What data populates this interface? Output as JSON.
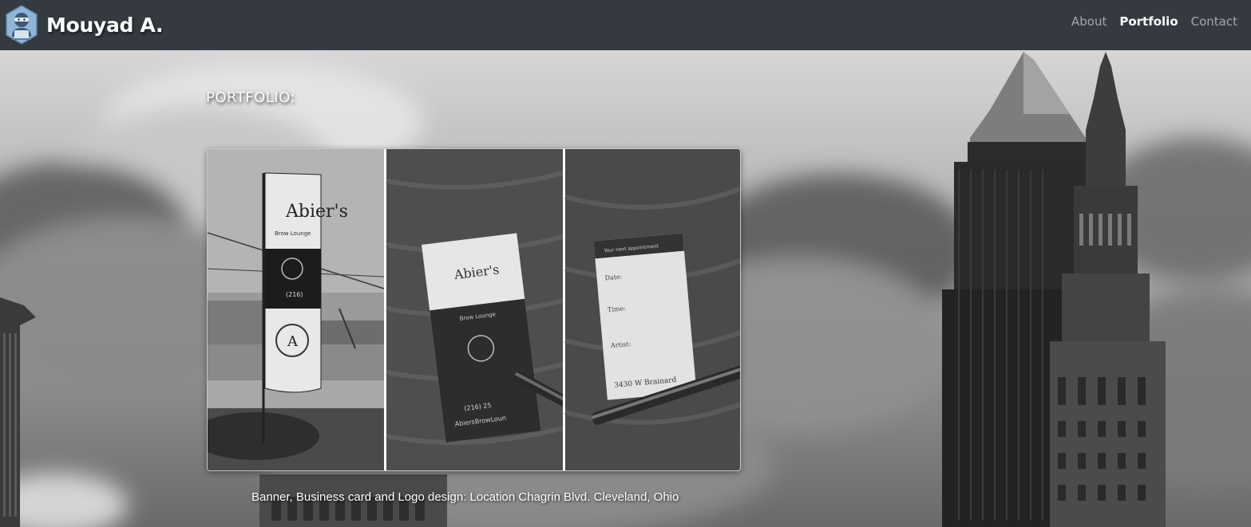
{
  "navbar": {
    "brand_name": "Mouyad A.",
    "links": [
      {
        "label": "About",
        "active": false
      },
      {
        "label": "Portfolio",
        "active": true
      },
      {
        "label": "Contact",
        "active": false
      }
    ]
  },
  "portfolio": {
    "title": "PORTFOLIO:",
    "caption": "Banner, Business card and Logo design: Location Chagrin Blvd. Cleveland, Ohio",
    "images": [
      {
        "icon": "banner-photo",
        "flag_text": [
          "Abier's",
          "Brow Lounge",
          "(216)"
        ]
      },
      {
        "icon": "business-card-photo",
        "card_text": [
          "Abier's",
          "Brow Lounge",
          "(216) 25",
          "AbiersBrowLoun"
        ]
      },
      {
        "icon": "appointment-card-photo",
        "card_text": [
          "Your next appointment",
          "Date:",
          "Time:",
          "Artist:",
          "3430 W Brainard"
        ]
      }
    ]
  },
  "colors": {
    "navbar": "#343a40",
    "nav_active": "#ffffff",
    "nav_inactive": "#9a9da0",
    "text": "#ffffff"
  }
}
